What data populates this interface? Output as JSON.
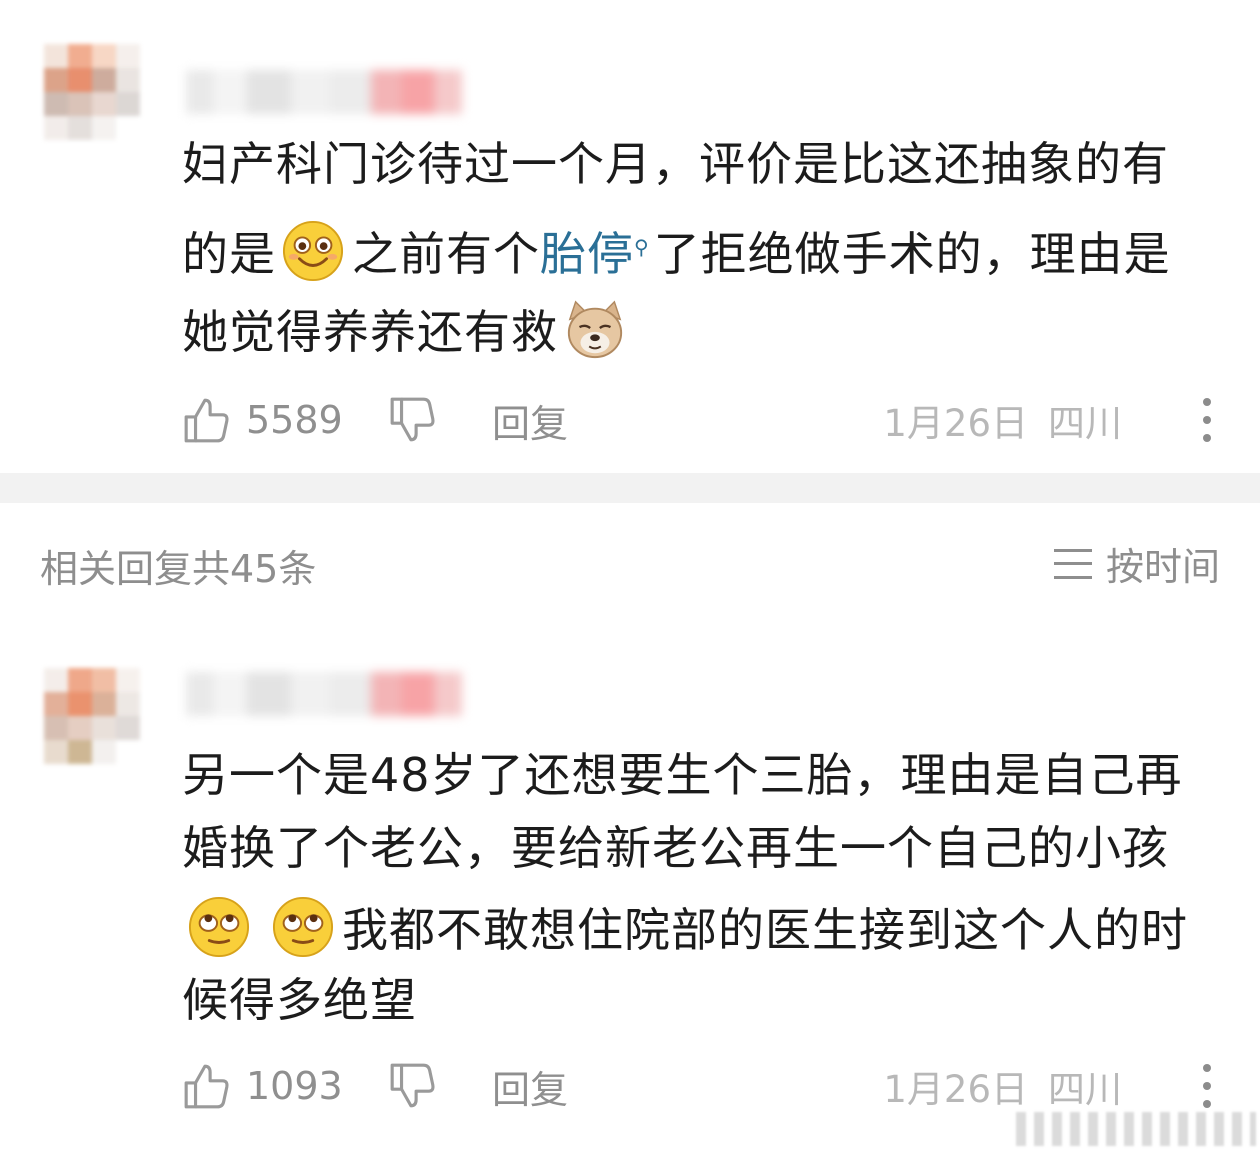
{
  "comments": [
    {
      "text_1": "妇产科门诊待过一个月，评价是比这还抽象的有",
      "text_2a": "的是",
      "text_2b": "之前有个",
      "link": "胎停",
      "text_2c": "了拒绝做手术的，理由是",
      "text_3": "她觉得养养还有救",
      "likes": "5589",
      "reply_label": "回复",
      "date": "1月26日",
      "location": "四川"
    },
    {
      "text_1": "另一个是48岁了还想要生个三胎，理由是自己再",
      "text_2": "婚换了个老公，要给新老公再生一个自己的小孩",
      "text_3": "我都不敢想住院部的医生接到这个人的时",
      "text_4": "候得多绝望",
      "likes": "1093",
      "reply_label": "回复",
      "date": "1月26日",
      "location": "四川"
    }
  ],
  "replies_header": "相关回复共45条",
  "sort_label": "按时间",
  "icons": {
    "like": "thumbs-up-icon",
    "dislike": "thumbs-down-icon",
    "more": "more-vertical-icon",
    "sort": "sort-lines-icon",
    "search": "search-icon"
  },
  "colors": {
    "link": "#2a6f96",
    "meta": "#b8b8b8",
    "divider": "#f2f2f2"
  }
}
